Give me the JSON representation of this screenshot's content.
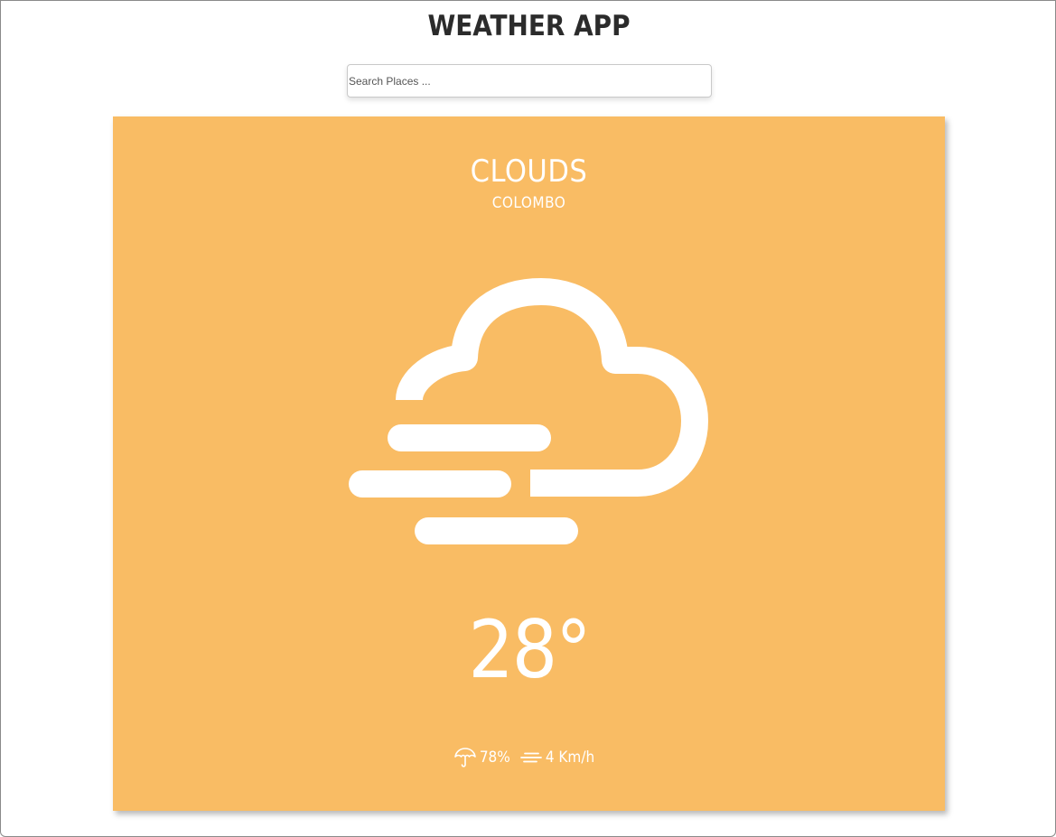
{
  "header": {
    "title": "WEATHER APP"
  },
  "search": {
    "placeholder": "Search Places ...",
    "value": ""
  },
  "weather": {
    "condition": "CLOUDS",
    "location": "COLOMBO",
    "temperature": "28°",
    "icon": "cloud-fog-icon",
    "humidity": "78%",
    "humidity_icon": "umbrella-icon",
    "wind": "4 Km/h",
    "wind_icon": "wind-icon"
  },
  "colors": {
    "card_background": "#f9bc64",
    "title_text": "#2b2b2b",
    "card_text": "#ffffff"
  }
}
